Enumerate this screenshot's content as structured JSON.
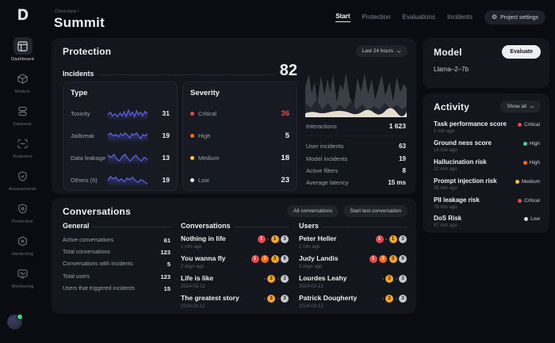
{
  "app": {
    "logo_letter": "D",
    "breadcrumb": "Overview /",
    "title": "Summit"
  },
  "topnav": {
    "items": [
      {
        "label": "Start"
      },
      {
        "label": "Protection"
      },
      {
        "label": "Evaluations"
      },
      {
        "label": "Incidents"
      }
    ],
    "settings_label": "Project settings"
  },
  "sidebar": {
    "items": [
      {
        "label": "Dashboard"
      },
      {
        "label": "Models"
      },
      {
        "label": "Datasets"
      },
      {
        "label": "Scanners"
      },
      {
        "label": "Assessments"
      },
      {
        "label": "Protection"
      },
      {
        "label": "Hardening"
      },
      {
        "label": "Monitoring"
      }
    ]
  },
  "protection": {
    "title": "Protection",
    "time_filter": "Last 24 hours",
    "incidents_label": "Incidents",
    "incidents_total": "82",
    "type": {
      "title": "Type",
      "rows": [
        {
          "label": "Toxicity",
          "value": "31"
        },
        {
          "label": "Jailbreak",
          "value": "19"
        },
        {
          "label": "Data leakage",
          "value": "13"
        },
        {
          "label": "Others (5)",
          "value": "19"
        }
      ]
    },
    "severity": {
      "title": "Severity",
      "rows": [
        {
          "label": "Critical",
          "value": "36",
          "dot": "#e5484d",
          "value_color": "#e5484d"
        },
        {
          "label": "High",
          "value": "5",
          "dot": "#f76b15",
          "value_color": "#f0f1f3"
        },
        {
          "label": "Medium",
          "value": "18",
          "dot": "#ffc53d",
          "value_color": "#f0f1f3"
        },
        {
          "label": "Low",
          "value": "23",
          "dot": "#e6e6e6",
          "value_color": "#f0f1f3"
        }
      ]
    },
    "stats": {
      "interactions": {
        "label": "Interactions",
        "value": "1 623"
      },
      "rows": [
        {
          "label": "User incidents",
          "value": "63"
        },
        {
          "label": "Model incidents",
          "value": "19"
        },
        {
          "label": "Active filters",
          "value": "8"
        },
        {
          "label": "Average latency",
          "value": "15 ms"
        }
      ]
    }
  },
  "conversations": {
    "title": "Conversations",
    "buttons": {
      "all": "All conversations",
      "start_test": "Start test conversation"
    },
    "general": {
      "title": "General",
      "rows": [
        {
          "label": "Active conversations",
          "value": "61"
        },
        {
          "label": "Total conversations",
          "value": "123"
        },
        {
          "label": "Conversations with incidents",
          "value": "5"
        },
        {
          "label": "Total users",
          "value": "123"
        },
        {
          "label": "Users that triggered incidents",
          "value": "15"
        }
      ]
    },
    "list": {
      "title": "Conversations",
      "items": [
        {
          "title": "Nothing in life",
          "time": "1 min ago",
          "badges": [
            {
              "k": "critical",
              "t": "1"
            },
            {
              "k": "sep"
            },
            {
              "k": "medium",
              "t": "1"
            },
            {
              "k": "low",
              "t": "3"
            }
          ]
        },
        {
          "title": "You wanna fly",
          "time": "2 days ago",
          "badges": [
            {
              "k": "critical",
              "t": "1"
            },
            {
              "k": "high",
              "t": "3"
            },
            {
              "k": "medium",
              "t": "3"
            },
            {
              "k": "low",
              "t": "9"
            }
          ]
        },
        {
          "title": "Life is like",
          "time": "2024-03-12",
          "badges": [
            {
              "k": "sep"
            },
            {
              "k": "medium",
              "t": "3"
            },
            {
              "k": "sep"
            },
            {
              "k": "low",
              "t": "3"
            }
          ]
        },
        {
          "title": "The greatest story",
          "time": "2024-03-12",
          "badges": [
            {
              "k": "sep"
            },
            {
              "k": "medium",
              "t": "3"
            },
            {
              "k": "sep"
            },
            {
              "k": "low",
              "t": "3"
            }
          ]
        }
      ]
    },
    "users": {
      "title": "Users",
      "items": [
        {
          "title": "Peter Heller",
          "time": "1 min ago",
          "badges": [
            {
              "k": "critical",
              "t": "1"
            },
            {
              "k": "sep"
            },
            {
              "k": "medium",
              "t": "1"
            },
            {
              "k": "low",
              "t": "3"
            }
          ]
        },
        {
          "title": "Judy Landis",
          "time": "2 days ago",
          "badges": [
            {
              "k": "critical",
              "t": "1"
            },
            {
              "k": "high",
              "t": "3"
            },
            {
              "k": "medium",
              "t": "3"
            },
            {
              "k": "low",
              "t": "9"
            }
          ]
        },
        {
          "title": "Lourdes Leahy",
          "time": "2024-03-12",
          "badges": [
            {
              "k": "sep"
            },
            {
              "k": "medium",
              "t": "3"
            },
            {
              "k": "sep"
            },
            {
              "k": "low",
              "t": "3"
            }
          ]
        },
        {
          "title": "Patrick Dougherty",
          "time": "2024-03-12",
          "badges": [
            {
              "k": "sep"
            },
            {
              "k": "medium",
              "t": "3"
            },
            {
              "k": "sep"
            },
            {
              "k": "low",
              "t": "3"
            }
          ]
        }
      ]
    }
  },
  "model": {
    "title": "Model",
    "evaluate_label": "Evaluate",
    "name": "Llama–2–7b"
  },
  "activity": {
    "title": "Activity",
    "filter_label": "Show all",
    "items": [
      {
        "name": "Task performance score",
        "time": "1 min ago",
        "severity": "Critical",
        "color": "#e5484d"
      },
      {
        "name": "Ground ness score",
        "time": "14 min ago",
        "severity": "High",
        "color": "#3dd68c"
      },
      {
        "name": "Hallucination risk",
        "time": "22 min ago",
        "severity": "High",
        "color": "#f76b15"
      },
      {
        "name": "Prompt injection risk",
        "time": "36 min ago",
        "severity": "Medium",
        "color": "#ffc53d"
      },
      {
        "name": "PII leakage risk",
        "time": "78 min ago",
        "severity": "Critical",
        "color": "#e5484d"
      },
      {
        "name": "DoS Risk",
        "time": "87 min ago",
        "severity": "Low",
        "color": "#d9d9d9"
      }
    ]
  },
  "badge_colors": {
    "critical": "#e5484d",
    "high": "#f76b15",
    "medium": "#f5a623",
    "low": "#c7c9cc"
  }
}
